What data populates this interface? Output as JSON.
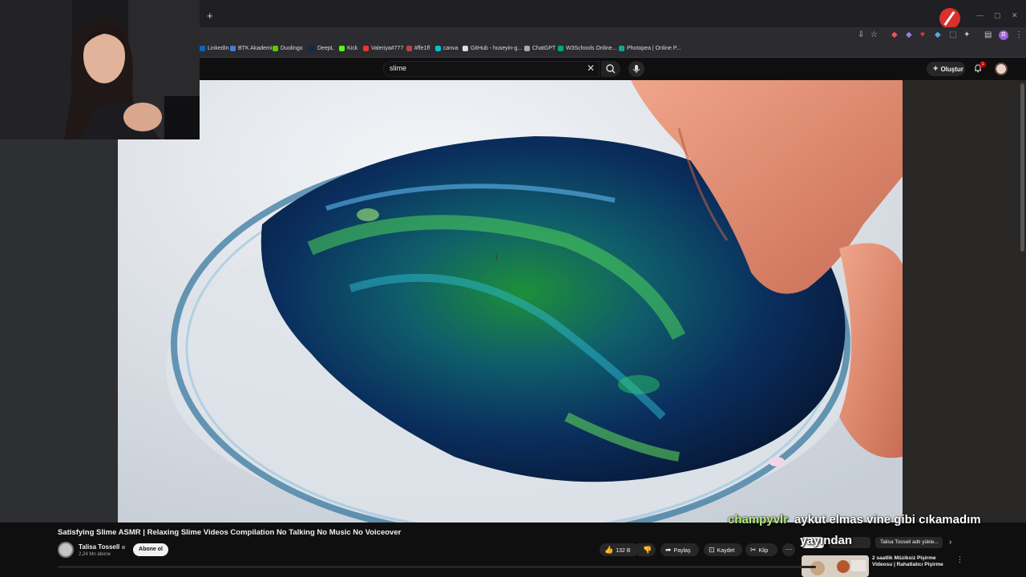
{
  "browser": {
    "new_tab": "+",
    "bookmarks": [
      {
        "label": "LinkedIn",
        "color": "#0a66c2"
      },
      {
        "label": "BTK Akademi",
        "color": "#4a7bd1"
      },
      {
        "label": "Duolingo",
        "color": "#58cc02"
      },
      {
        "label": "DeepL",
        "color": "#0f2b46"
      },
      {
        "label": "Kick",
        "color": "#53fc18"
      },
      {
        "label": "Valeriya#777",
        "color": "#e33"
      },
      {
        "label": "#ffe1ff",
        "color": "#b44"
      },
      {
        "label": "canva",
        "color": "#00c4cc"
      },
      {
        "label": "GitHub - huseyin-g...",
        "color": "#ddd"
      },
      {
        "label": "ChatGPT",
        "color": "#aaa"
      },
      {
        "label": "W3Schools Online...",
        "color": "#04aa6d"
      },
      {
        "label": "Photopea | Online P...",
        "color": "#18a497"
      }
    ],
    "profile_initial": "R"
  },
  "youtube": {
    "search": {
      "query": "slime"
    },
    "create_label": "Oluştur",
    "notification_count": "1"
  },
  "video": {
    "title": "Satisfying Slime ASMR | Relaxing Slime Videos Compilation No Talking No Music No Voiceover",
    "channel": {
      "name": "Talisa Tossell",
      "verified_mark": "⊘",
      "subscribers": "2,24 Mn abone"
    },
    "subscribe_label": "Abone ol",
    "actions": {
      "likes": "132 B",
      "share": "Paylaş",
      "save": "Kaydet",
      "clip": "Klip"
    }
  },
  "sidebar": {
    "chips": [
      "Tümü",
      "Dizden",
      "Talisa Tossell adlı yükle..."
    ],
    "recommendation": {
      "title": "2 saatlik Müziksiz Pişirme Videosu | Rahatlatıcı Pişirme"
    }
  },
  "chat_overlay": {
    "username": "champyvlr",
    "message_line1": "aykut elmas vine gibi cıkamadım",
    "message_line2": "yayından",
    "username_color": "#b6f07a"
  }
}
